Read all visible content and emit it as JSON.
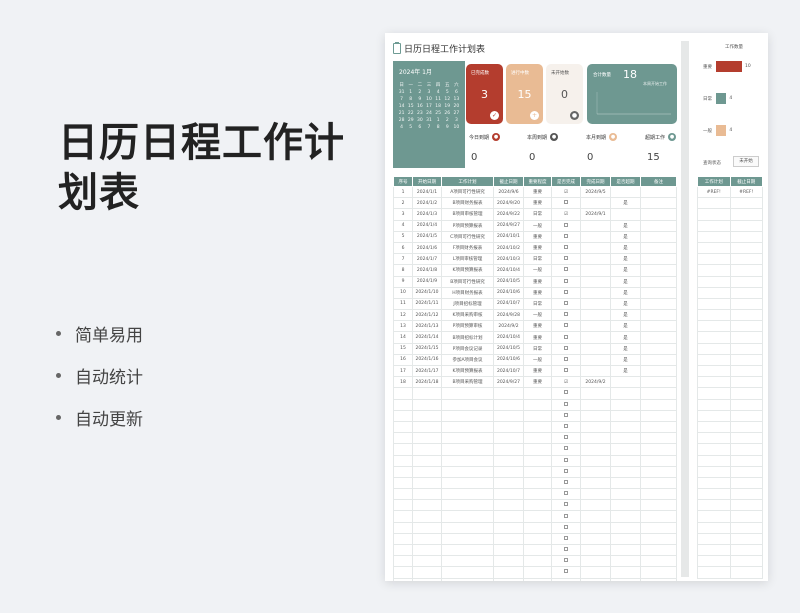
{
  "promo": {
    "title": "日历日程工作计划表",
    "features": [
      "简单易用",
      "自动统计",
      "自动更新"
    ]
  },
  "sheet": {
    "title": "日历日程工作计划表",
    "calendar": {
      "header": "2024年 1月",
      "weekdays": [
        "日",
        "一",
        "二",
        "三",
        "四",
        "五",
        "六"
      ],
      "days": [
        "31",
        "1",
        "2",
        "3",
        "4",
        "5",
        "6",
        "7",
        "8",
        "9",
        "10",
        "11",
        "12",
        "13",
        "14",
        "15",
        "16",
        "17",
        "18",
        "19",
        "20",
        "21",
        "22",
        "23",
        "24",
        "25",
        "26",
        "27",
        "28",
        "29",
        "30",
        "31",
        "1",
        "2",
        "3",
        "4",
        "5",
        "6",
        "7",
        "8",
        "9",
        "10"
      ]
    },
    "cards": {
      "done": {
        "label": "已完成数",
        "value": "3",
        "icon": "check-icon"
      },
      "doing": {
        "label": "进行中数",
        "value": "15",
        "icon": "plus-icon"
      },
      "todo": {
        "label": "未开始数",
        "value": "0",
        "icon": "person-icon"
      }
    },
    "total": {
      "label": "合计数量",
      "value": "18",
      "sub": "本周开始工作"
    },
    "deadlines": [
      {
        "label": "今日到期",
        "value": "0",
        "color": "#b43d2e"
      },
      {
        "label": "本周到期",
        "value": "0",
        "color": "#555555"
      },
      {
        "label": "本月到期",
        "value": "0",
        "color": "#e9bb94"
      },
      {
        "label": "超期工作",
        "value": "15",
        "color": "#6e9891"
      }
    ],
    "table": {
      "headers": [
        "序号",
        "开始日期",
        "工作计划",
        "截止日期",
        "重要程度",
        "是否完成",
        "完成日期",
        "是否超期",
        "备注"
      ],
      "rows": [
        [
          "1",
          "2024/1/1",
          "A项目可行性研究",
          "2024/9/6",
          "重要",
          "done",
          "2024/9/5",
          "",
          ""
        ],
        [
          "2",
          "2024/1/2",
          "B项目财务报表",
          "2024/9/20",
          "重要",
          "box",
          "",
          "是",
          ""
        ],
        [
          "3",
          "2024/1/3",
          "B项目审核管理",
          "2024/9/22",
          "日常",
          "done",
          "2024/9/1",
          "",
          ""
        ],
        [
          "4",
          "2024/1/4",
          "P项目预算报表",
          "2024/9/27",
          "一般",
          "box",
          "",
          "是",
          ""
        ],
        [
          "5",
          "2024/1/5",
          "C项目可行性研究",
          "2024/10/1",
          "重要",
          "box",
          "",
          "是",
          ""
        ],
        [
          "6",
          "2024/1/6",
          "F项目财务报表",
          "2024/10/2",
          "重要",
          "box",
          "",
          "是",
          ""
        ],
        [
          "7",
          "2024/1/7",
          "L项目审核管理",
          "2024/10/3",
          "日常",
          "box",
          "",
          "是",
          ""
        ],
        [
          "8",
          "2024/1/8",
          "K项目预算报表",
          "2024/10/4",
          "一般",
          "box",
          "",
          "是",
          ""
        ],
        [
          "9",
          "2024/1/9",
          "B项目可行性研究",
          "2024/10/5",
          "重要",
          "box",
          "",
          "是",
          ""
        ],
        [
          "10",
          "2024/1/10",
          "H项目财务报表",
          "2024/10/6",
          "重要",
          "box",
          "",
          "是",
          ""
        ],
        [
          "11",
          "2024/1/11",
          "J项目招标管理",
          "2024/10/7",
          "日常",
          "box",
          "",
          "是",
          ""
        ],
        [
          "12",
          "2024/1/12",
          "K项目采购审核",
          "2024/9/28",
          "一般",
          "box",
          "",
          "是",
          ""
        ],
        [
          "13",
          "2024/1/13",
          "P项目预算审核",
          "2024/9/2",
          "重要",
          "box",
          "",
          "是",
          ""
        ],
        [
          "14",
          "2024/1/14",
          "B项目招标计划",
          "2024/10/4",
          "重要",
          "box",
          "",
          "是",
          ""
        ],
        [
          "15",
          "2024/1/15",
          "P项目会议记录",
          "2024/10/5",
          "日常",
          "box",
          "",
          "是",
          ""
        ],
        [
          "16",
          "2024/1/16",
          "参加A项目会议",
          "2024/10/6",
          "一般",
          "box",
          "",
          "是",
          ""
        ],
        [
          "17",
          "2024/1/17",
          "K项目预算报表",
          "2024/10/7",
          "重要",
          "box",
          "",
          "是",
          ""
        ],
        [
          "18",
          "2024/1/18",
          "B项目采购管理",
          "2024/9/27",
          "重要",
          "done",
          "2024/9/2",
          "",
          ""
        ]
      ],
      "empty_rows": 19
    }
  },
  "panel": {
    "title": "工作数量",
    "bars": [
      {
        "label": "重要",
        "value": 10,
        "color": "#b43d2e"
      },
      {
        "label": "日常",
        "value": 4,
        "color": "#6e9891"
      },
      {
        "label": "一般",
        "value": 4,
        "color": "#e9bb94"
      }
    ],
    "query_label": "查询状态",
    "query_value": "未开始",
    "table_headers": [
      "工作计划",
      "截止日期"
    ],
    "table_row": [
      "#REF!",
      "#REF!"
    ],
    "empty_rows": 34
  },
  "colors": {
    "teal": "#6e9891",
    "red": "#b43d2e",
    "peach": "#e9bb94"
  }
}
